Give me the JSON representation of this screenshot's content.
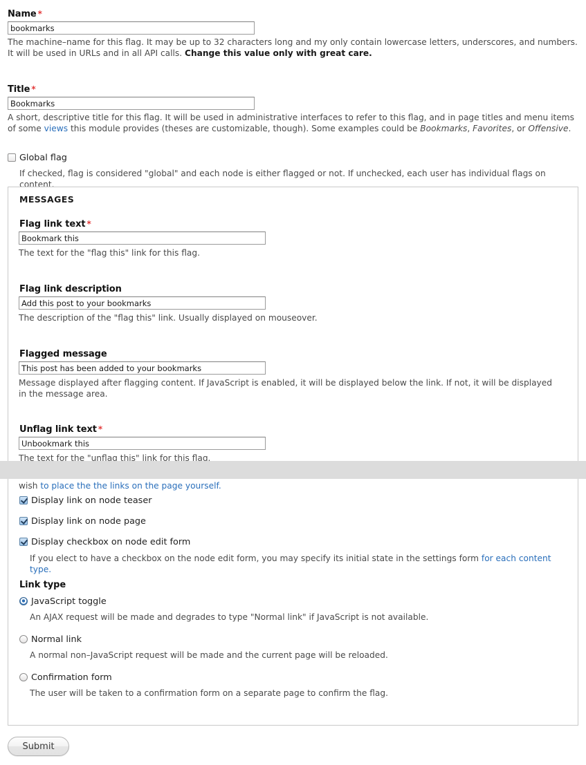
{
  "name_field": {
    "label": "Name",
    "required_marker": "*",
    "value": "bookmarks",
    "description_1": "The machine–name for this flag. It may be up to 32 characters long and my only contain lowercase letters, underscores, and numbers. It will be used in URLs and in all API calls. ",
    "description_bold": "Change this value only with great care."
  },
  "title_field": {
    "label": "Title",
    "required_marker": "*",
    "value": "Bookmarks",
    "description_1": "A short, descriptive title for this flag. It will be used in administrative interfaces to refer to this flag, and in page titles and menu items of some ",
    "link": "views",
    "description_2": " this module provides (theses are customizable, though). Some examples could be ",
    "example_1": "Bookmarks",
    "sep_1": ", ",
    "example_2": "Favorites",
    "sep_2": ", or ",
    "example_3": "Offensive",
    "sep_3": "."
  },
  "global_flag": {
    "label": "Global flag",
    "checked": false,
    "description": "If checked, flag is considered \"global\" and each node is either flagged or not. If unchecked, each user has individual flags on content."
  },
  "messages_fieldset": {
    "legend": "MESSAGES",
    "flag_link_text": {
      "label": "Flag link text",
      "required_marker": "*",
      "value": "Bookmark this",
      "description": "The text for the \"flag this\" link for this flag."
    },
    "flag_link_description": {
      "label": "Flag link description",
      "value": "Add this post to your bookmarks",
      "description": "The description of the \"flag this\" link. Usually displayed on mouseover."
    },
    "flagged_message": {
      "label": "Flagged message",
      "value": "This post has been added to your bookmarks",
      "description": "Message displayed after flagging content. If JavaScript is enabled, it will be displayed below the link. If not, it will be displayed in the message area."
    },
    "unflag_link_text": {
      "label": "Unflag link text",
      "required_marker": "*",
      "value": "Unbookmark this",
      "description": "The text for the \"unflag this\" link for this flag."
    }
  },
  "display_fieldset": {
    "partial_text_prefix": "wish ",
    "partial_text_link": "to place the the links on the page yourself.",
    "checkboxes": [
      {
        "label": "Display link on node teaser",
        "checked": true
      },
      {
        "label": "Display link on node page",
        "checked": true
      },
      {
        "label": "Display checkbox on node edit form",
        "checked": true
      }
    ],
    "checkbox_description_prefix": "If you elect to have a checkbox on the node edit form, you may specify its initial state in the settings form ",
    "checkbox_description_link": "for each content type.",
    "link_type": {
      "label": "Link type",
      "options": [
        {
          "label": "JavaScript toggle",
          "selected": true,
          "description": "An AJAX request will be made and degrades to type \"Normal link\" if JavaScript is not available."
        },
        {
          "label": "Normal link",
          "selected": false,
          "description": "A normal non–JavaScript request will be made and the current page will be reloaded."
        },
        {
          "label": "Confirmation form",
          "selected": false,
          "description": "The user will be taken to a confirmation form on a separate page to confirm the flag."
        }
      ]
    }
  },
  "submit_button": {
    "label": "Submit"
  },
  "colors": {
    "link": "#2a6fbb",
    "required": "#e33a3a",
    "fieldset_border": "#c9c9c9",
    "input_border": "#9a9a9a",
    "occlusion_band": "#dcdcdc"
  }
}
